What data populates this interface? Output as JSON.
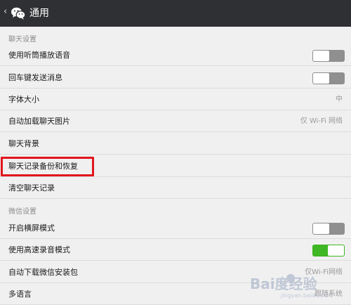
{
  "header": {
    "back_glyph": "‹",
    "app_icon": "wechat-logo-icon",
    "title": "通用"
  },
  "sections": [
    {
      "title": "聊天设置",
      "items": [
        {
          "label": "使用听筒播放语音",
          "control": "toggle",
          "state": "off"
        },
        {
          "label": "回车键发送消息",
          "control": "toggle",
          "state": "off"
        },
        {
          "label": "字体大小",
          "control": "value",
          "value": "中"
        },
        {
          "label": "自动加载聊天图片",
          "control": "value",
          "value": "仅 Wi-Fi 网络"
        },
        {
          "label": "聊天背景",
          "control": "none"
        },
        {
          "label": "聊天记录备份和恢复",
          "control": "none",
          "highlighted": true
        },
        {
          "label": "清空聊天记录",
          "control": "none"
        }
      ]
    },
    {
      "title": "微信设置",
      "items": [
        {
          "label": "开启横屏模式",
          "control": "toggle",
          "state": "off"
        },
        {
          "label": "使用高速录音模式",
          "control": "toggle",
          "state": "on"
        },
        {
          "label": "自动下载微信安装包",
          "control": "value",
          "value": "仅Wi-Fi网络"
        },
        {
          "label": "多语言",
          "control": "value",
          "value": "跟随系统"
        }
      ]
    }
  ],
  "colors": {
    "header_bg": "#2f3033",
    "page_bg": "#f0f0f0",
    "toggle_off": "#8f8f8f",
    "toggle_on": "#3fb624",
    "highlight_border": "#e1161c"
  },
  "watermark": {
    "text": "Bai度经验",
    "subtext": "jingyan.baidu.com"
  }
}
